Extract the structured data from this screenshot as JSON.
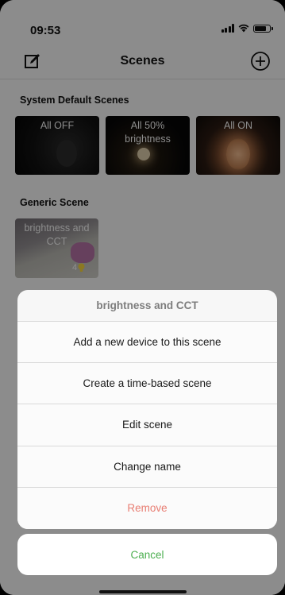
{
  "status_bar": {
    "time": "09:53"
  },
  "nav": {
    "title": "Scenes",
    "edit_icon": "edit-icon",
    "add_icon": "add-circle-icon"
  },
  "system_scenes": {
    "title": "System Default Scenes",
    "items": [
      {
        "label": "All OFF"
      },
      {
        "label": "All 50% brightness"
      },
      {
        "label": "All ON"
      }
    ]
  },
  "generic_scenes": {
    "title": "Generic Scene",
    "items": [
      {
        "label": "brightness and CCT",
        "device_count": "4"
      }
    ]
  },
  "action_sheet": {
    "title": "brightness and CCT",
    "items": [
      "Add a new device to this scene",
      "Create a time-based scene",
      "Edit scene",
      "Change name",
      "Remove"
    ],
    "cancel_label": "Cancel"
  },
  "colors": {
    "remove": "#e87d72",
    "cancel": "#4caf50"
  }
}
